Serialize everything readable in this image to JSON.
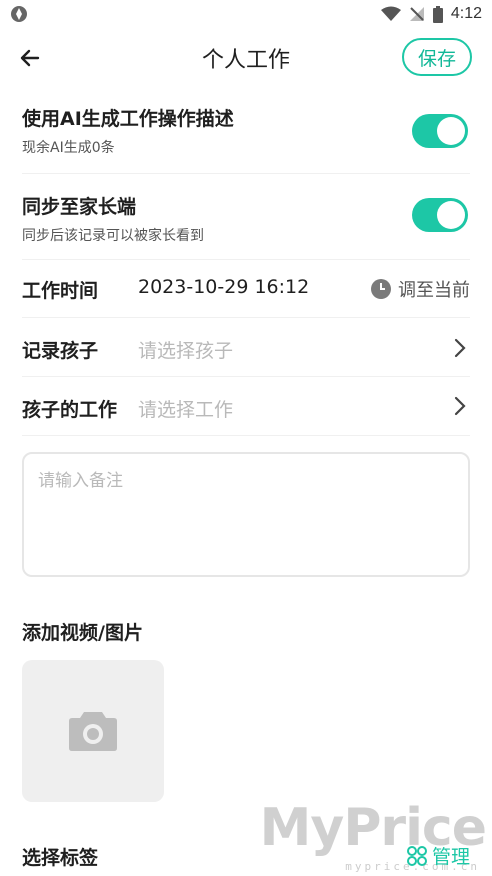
{
  "status_bar": {
    "time": "4:12",
    "icons": [
      "app-icon",
      "wifi-icon",
      "no-signal-icon",
      "battery-icon"
    ]
  },
  "header": {
    "title": "个人工作",
    "save_label": "保存"
  },
  "ai_toggle": {
    "title": "使用AI生成工作操作描述",
    "subtitle": "现余AI生成0条",
    "enabled": true
  },
  "sync_toggle": {
    "title": "同步至家长端",
    "subtitle": "同步后该记录可以被家长看到",
    "enabled": true
  },
  "work_time": {
    "label": "工作时间",
    "value": "2023-10-29 16:12",
    "adjust_label": "调至当前"
  },
  "record_child": {
    "label": "记录孩子",
    "placeholder": "请选择孩子"
  },
  "child_work": {
    "label": "孩子的工作",
    "placeholder": "请选择工作"
  },
  "note": {
    "placeholder": "请输入备注"
  },
  "media": {
    "title": "添加视频/图片"
  },
  "tags": {
    "title": "选择标签",
    "manage_label": "管理"
  },
  "watermark": {
    "brand": "MyPrice",
    "domain": "myprice.com.cn"
  },
  "colors": {
    "accent": "#1dc7a6",
    "placeholder": "#b9b9b9"
  }
}
